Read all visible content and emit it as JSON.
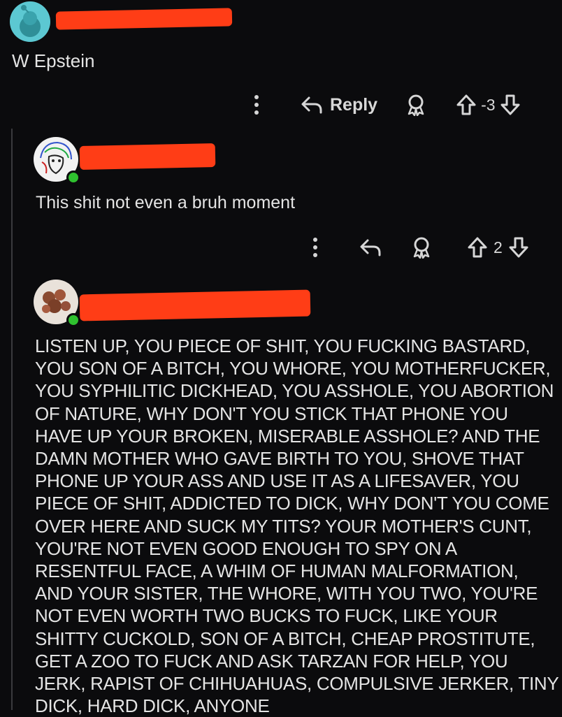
{
  "comments": [
    {
      "text": "W Epstein",
      "actions": {
        "reply_label": "Reply",
        "score": "-3"
      }
    },
    {
      "text": "This shit not even a bruh moment",
      "actions": {
        "score": "2"
      }
    },
    {
      "text": "LISTEN UP, YOU PIECE OF SHIT, YOU FUCKING BASTARD, YOU SON OF A BITCH, YOU WHORE, YOU MOTHERFUCKER, YOU SYPHILITIC DICKHEAD, YOU ASSHOLE, YOU ABORTION OF NATURE, WHY DON'T YOU STICK THAT PHONE YOU HAVE UP YOUR BROKEN, MISERABLE ASSHOLE? AND THE DAMN MOTHER WHO GAVE BIRTH TO YOU, SHOVE THAT PHONE UP YOUR ASS AND USE IT AS A LIFESAVER, YOU PIECE OF SHIT, ADDICTED TO DICK, WHY DON'T YOU COME OVER HERE AND SUCK MY TITS? YOUR MOTHER'S CUNT, YOU'RE NOT EVEN GOOD ENOUGH TO SPY ON A RESENTFUL FACE, A WHIM OF HUMAN MALFORMATION, AND YOUR SISTER, THE WHORE, WITH YOU TWO, YOU'RE NOT EVEN WORTH TWO BUCKS TO FUCK, LIKE YOUR SHITTY CUCKOLD, SON OF A BITCH, CHEAP PROSTITUTE, GET A ZOO TO FUCK AND ASK TARZAN FOR HELP, YOU JERK, RAPIST OF CHIHUAHUAS, COMPULSIVE JERKER, TINY DICK, HARD DICK, ANYONE"
    }
  ],
  "icons": {
    "more": "more-vertical-icon",
    "reply": "reply-arrow-icon",
    "award": "award-icon",
    "upvote": "upvote-icon",
    "downvote": "downvote-icon"
  },
  "colors": {
    "background": "#0b0b0d",
    "redaction": "#ff3d16",
    "online": "#2fc12f",
    "avatar_teal": "#5cc8d2"
  }
}
